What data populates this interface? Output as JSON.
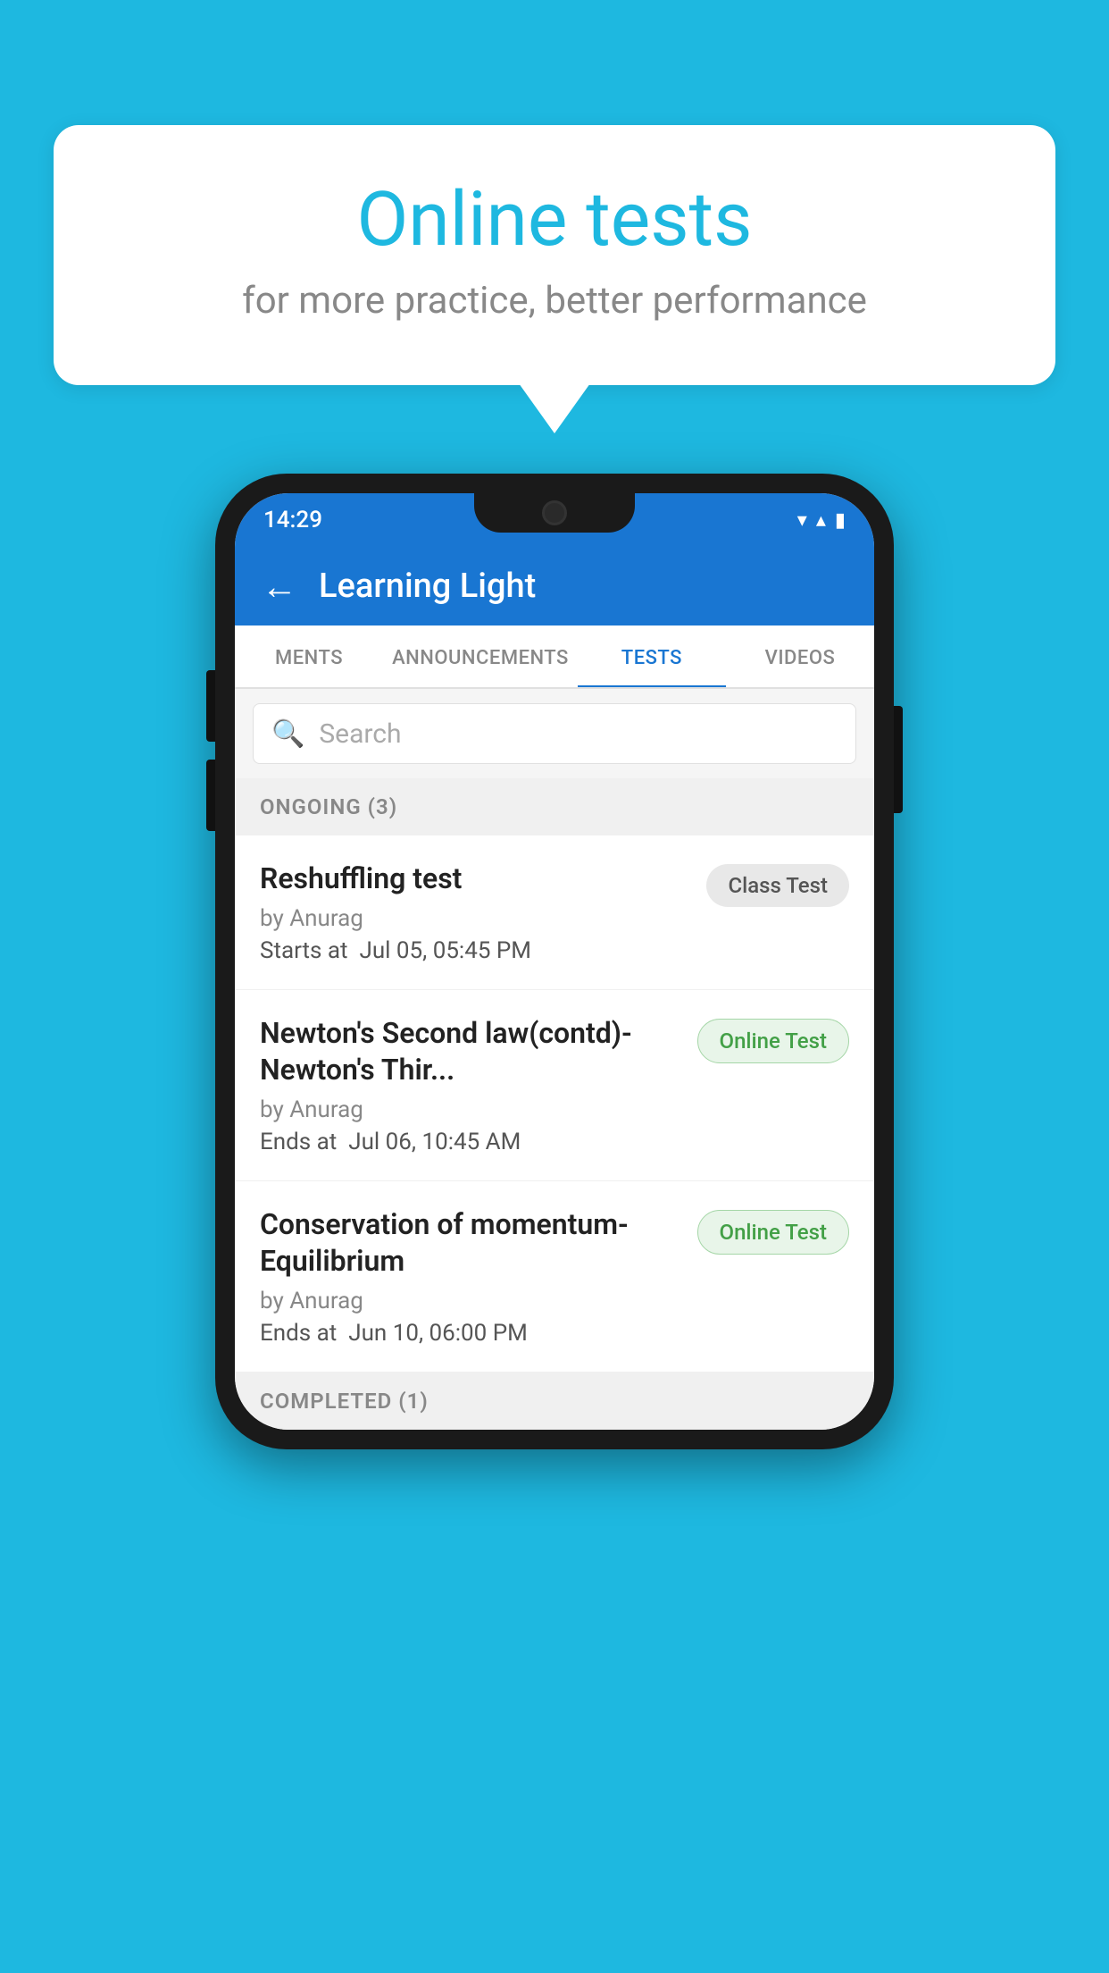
{
  "background_color": "#1eb8e0",
  "bubble": {
    "title": "Online tests",
    "subtitle": "for more practice, better performance"
  },
  "status_bar": {
    "time": "14:29",
    "wifi": "▾",
    "signal": "▾",
    "battery": "▮"
  },
  "header": {
    "title": "Learning Light",
    "back_label": "←"
  },
  "tabs": [
    {
      "label": "MENTS",
      "active": false
    },
    {
      "label": "ANNOUNCEMENTS",
      "active": false
    },
    {
      "label": "TESTS",
      "active": true
    },
    {
      "label": "VIDEOS",
      "active": false
    }
  ],
  "search": {
    "placeholder": "Search"
  },
  "ongoing_section": {
    "label": "ONGOING (3)"
  },
  "tests": [
    {
      "name": "Reshuffling test",
      "by": "by Anurag",
      "date_label": "Starts at",
      "date": "Jul 05, 05:45 PM",
      "badge": "Class Test",
      "badge_type": "class"
    },
    {
      "name": "Newton's Second law(contd)-Newton's Thir...",
      "by": "by Anurag",
      "date_label": "Ends at",
      "date": "Jul 06, 10:45 AM",
      "badge": "Online Test",
      "badge_type": "online"
    },
    {
      "name": "Conservation of momentum-Equilibrium",
      "by": "by Anurag",
      "date_label": "Ends at",
      "date": "Jun 10, 06:00 PM",
      "badge": "Online Test",
      "badge_type": "online"
    }
  ],
  "completed_section": {
    "label": "COMPLETED (1)"
  }
}
